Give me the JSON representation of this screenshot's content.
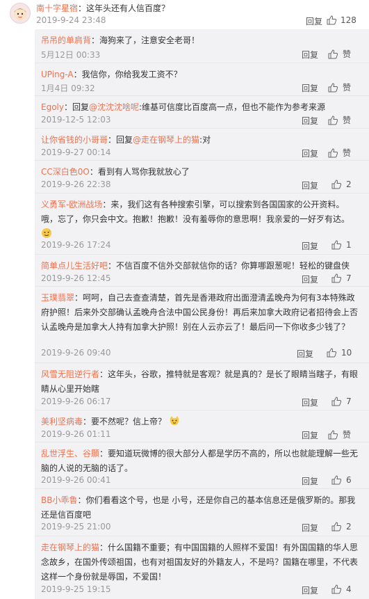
{
  "top_comment": {
    "username": "南十字星宿",
    "text": "：这年头还有人信百度？",
    "time": "2019-9-24 23:48",
    "reply_label": "回复",
    "likes": "128"
  },
  "replies": [
    {
      "user": "吊吊的单肩背",
      "pre": "：海狗来了，注意安全老哥！",
      "mention": "",
      "post": "",
      "time": "5月12日 00:33",
      "reply_label": "回复",
      "like_label": "赞"
    },
    {
      "user": "UPing-A",
      "pre": "：我信你，你给我发工资不？",
      "mention": "",
      "post": "",
      "time": "1月4日 09:32",
      "reply_label": "回复",
      "like_label": "赞"
    },
    {
      "user": "Egoly",
      "pre": "：回复",
      "mention": "@沈沈沈啥呢",
      "post": ":维基可信度比百度高一点，但也不能作为参考来源",
      "time": "2019-12-5 12:03",
      "reply_label": "回复",
      "like_label": "赞"
    },
    {
      "user": "让你省钱的小哥哥",
      "pre": "：回复",
      "mention": "@走在钢琴上的猫",
      "post": ":对",
      "time": "2019-9-27 00:14",
      "reply_label": "回复",
      "like_label": "赞"
    },
    {
      "user": "CC深白色0O",
      "pre": "：看到有人骂你我就放心了",
      "mention": "",
      "post": "",
      "time": "2019-9-26 22:38",
      "reply_label": "回复",
      "like_label": "2"
    },
    {
      "user": "义勇军-欧洲战场",
      "pre": "：来，我们这有各种搜索引擎，可以搜索到各国国家的公开资料。哦，忘了，你只会中文。抱歉！抱歉！没有羞辱你的意思啊！我亲爱的一好歹有达。",
      "mention": "",
      "post": "",
      "time": "2019-9-26 17:24",
      "reply_label": "回复",
      "like_label": "1"
    },
    {
      "user": "简单点儿生活好吧",
      "pre": "：不信百度不信外交部就信你的话？你算哪跟葱呢！轻松的键盘侠",
      "mention": "",
      "post": "",
      "time": "2019-9-26 12:45",
      "reply_label": "回复",
      "like_label": "7"
    },
    {
      "user": "玉璞翡翠",
      "pre": "：呵呵，自己去查查清楚，首先是香港政府出面澄清孟晚舟为何有3本特殊政府护照！后来外交部确认孟晚舟合法中国公民身份！再后来加拿大政府记者招待会上否认孟晚舟是加拿大人持有加拿大护照！别在人云亦云了！最后问一下你收多少钱了？",
      "mention": "",
      "post": "",
      "time": "2019-9-26 09:40",
      "reply_label": "回复",
      "like_label": "10"
    },
    {
      "user": "风雪无阻逆行者",
      "pre": "：这年头，谷歌，推特就是客观？就是真的？是长了眼睛当瞎子，有眼睛从心里开始瞎",
      "mention": "",
      "post": "",
      "time": "2019-9-26 06:17",
      "reply_label": "回复",
      "like_label": "7"
    },
    {
      "user": "美利坚病毒",
      "pre": "：要不然呢？信上帝？",
      "mention": "",
      "post": "",
      "time": "2019-9-26 01:11",
      "reply_label": "回复",
      "like_label": "赞"
    },
    {
      "user": "乱世浮生、谷願",
      "pre": "：要知道玩微博的很大部分人都是学历不高的，所以也就能理解一些无脑的人说的无脑的话了。",
      "mention": "",
      "post": "",
      "time": "2019-9-26 00:41",
      "reply_label": "回复",
      "like_label": "6"
    },
    {
      "user": "BB小乖鲁",
      "pre": "：你们看看这个号，也是 小号，还是你自己的基本信息还是俄罗斯的。那我还是信百度吧",
      "mention": "",
      "post": "",
      "time": "2019-9-25 21:00",
      "reply_label": "回复",
      "like_label": "2"
    },
    {
      "user": "走在钢琴上的猫",
      "pre": "：什么国籍不重要；有中国国籍的人照样不爱国！有外国国籍的华人思念故乡，在国外传颂祖国，也有对祖国友好的外籍友人，不是吗？国籍在哪里，不代表这样一个身份就是辱国，不爱国！",
      "mention": "",
      "post": "",
      "time": "2019-9-25 19:15",
      "reply_label": "回复",
      "like_label": "4"
    }
  ]
}
